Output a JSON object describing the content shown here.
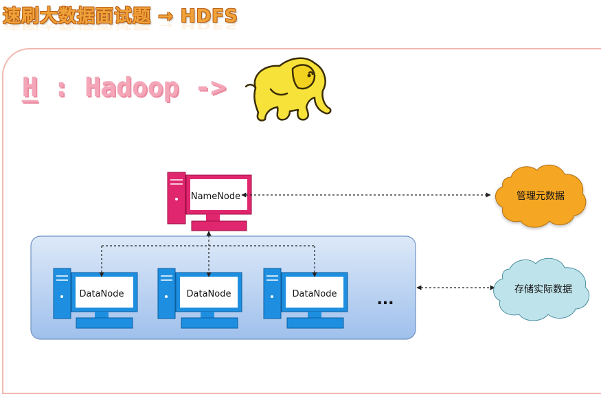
{
  "page": {
    "title": "速刷大数据面试题 → HDFS",
    "heading_letter": "H",
    "heading_rest": " : Hadoop ->"
  },
  "diagram": {
    "namenode_label": "NameNode",
    "datanode_labels": [
      "DataNode",
      "DataNode",
      "DataNode"
    ],
    "ellipsis": "...",
    "cloud_metadata_label": "管理元数据",
    "cloud_storage_label": "存储实际数据"
  },
  "colors": {
    "title_orange": "#f0a23a",
    "heading_pink": "#f4a6b8",
    "namenode_magenta": "#e0266e",
    "datanode_blue": "#1e8fe0",
    "cluster_fill": "#c9dcf5",
    "cloud_orange": "#f5a623",
    "cloud_teal": "#bfe3ea",
    "elephant_yellow": "#f7e23a"
  },
  "icons": [
    "hadoop-elephant-logo",
    "computer-icon"
  ]
}
